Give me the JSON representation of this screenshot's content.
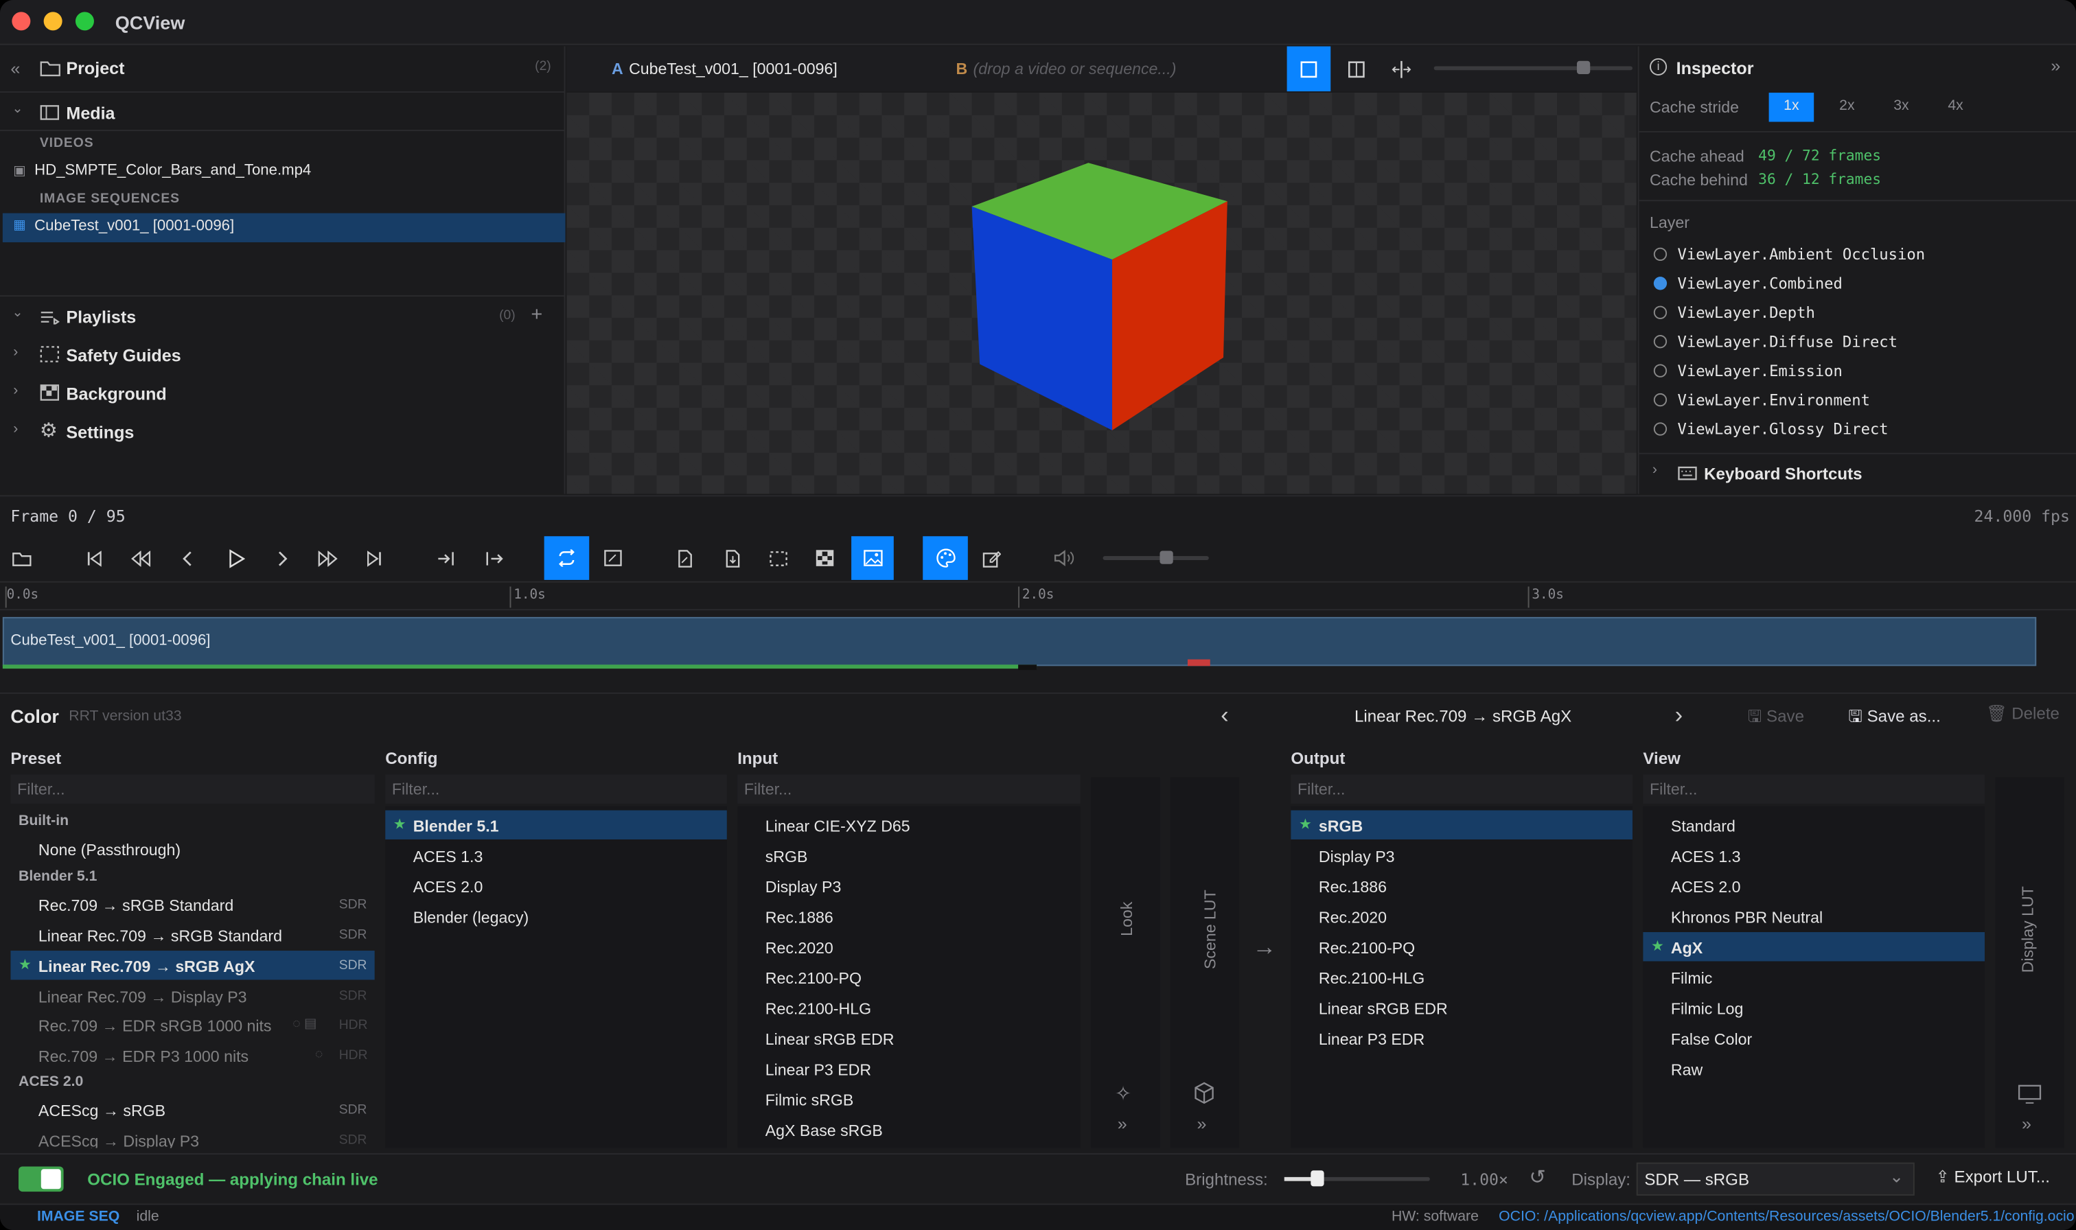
{
  "app": {
    "title": "QCView"
  },
  "project": {
    "title": "Project",
    "count": "(2)",
    "media_label": "Media",
    "videos_header": "VIDEOS",
    "videos": [
      "HD_SMPTE_Color_Bars_and_Tone.mp4"
    ],
    "seq_header": "IMAGE SEQUENCES",
    "sequences": [
      "CubeTest_v001_ [0001-0096]"
    ],
    "playlists_label": "Playlists",
    "playlists_count": "(0)",
    "safety_label": "Safety Guides",
    "background_label": "Background",
    "settings_label": "Settings"
  },
  "viewer": {
    "slot_a_letter": "A",
    "slot_a": "CubeTest_v001_ [0001-0096]",
    "slot_b_letter": "B",
    "slot_b": "(drop a video or sequence...)",
    "zoom_level": 0.75
  },
  "inspector": {
    "title": "Inspector",
    "cache_stride_label": "Cache stride",
    "strides": [
      "1x",
      "2x",
      "3x",
      "4x"
    ],
    "cache_ahead_label": "Cache ahead",
    "cache_ahead_value": "49 / 72 frames",
    "cache_behind_label": "Cache behind",
    "cache_behind_value": "36 / 12 frames",
    "layer_label": "Layer",
    "layers": [
      "ViewLayer.Ambient Occlusion",
      "ViewLayer.Combined",
      "ViewLayer.Depth",
      "ViewLayer.Diffuse Direct",
      "ViewLayer.Emission",
      "ViewLayer.Environment",
      "ViewLayer.Glossy Direct"
    ],
    "keyboard_label": "Keyboard Shortcuts"
  },
  "transport": {
    "frame": "Frame 0 / 95",
    "fps": "24.000 fps",
    "volume_level": 0.6
  },
  "timeline": {
    "ticks": [
      "0.0s",
      "1.0s",
      "2.0s",
      "3.0s"
    ],
    "clip": "CubeTest_v001_ [0001-0096]"
  },
  "color": {
    "title": "Color",
    "rrt": "RRT version ut33",
    "preset_name": "Linear Rec.709 → sRGB AgX",
    "save": "Save",
    "save_as": "Save as...",
    "delete": "Delete",
    "preset_header": "Preset",
    "config_header": "Config",
    "input_header": "Input",
    "output_header": "Output",
    "view_header": "View",
    "filter_placeholder": "Filter...",
    "builtin_label": "Built-in",
    "passthrough": "None (Passthrough)",
    "blender_label": "Blender 5.1",
    "aces_label": "ACES 2.0",
    "presets": [
      {
        "name": "Rec.709 → sRGB Standard",
        "tag": "SDR"
      },
      {
        "name": "Linear Rec.709 → sRGB Standard",
        "tag": "SDR"
      },
      {
        "name": "Linear Rec.709 → sRGB AgX",
        "tag": "SDR"
      },
      {
        "name": "Linear Rec.709 → Display P3",
        "tag": "SDR"
      },
      {
        "name": "Rec.709 → EDR sRGB 1000 nits",
        "tag": "HDR"
      },
      {
        "name": "Rec.709 → EDR P3 1000 nits",
        "tag": "HDR"
      }
    ],
    "aces_presets": [
      {
        "name": "ACEScg → sRGB",
        "tag": "SDR"
      },
      {
        "name": "ACEScg → Display P3",
        "tag": "SDR"
      }
    ],
    "configs": [
      "Blender 5.1",
      "ACES 1.3",
      "ACES 2.0",
      "Blender (legacy)"
    ],
    "inputs": [
      "Linear CIE-XYZ D65",
      "sRGB",
      "Display P3",
      "Rec.1886",
      "Rec.2020",
      "Rec.2100-PQ",
      "Rec.2100-HLG",
      "Linear sRGB EDR",
      "Linear P3 EDR",
      "Filmic sRGB",
      "AgX Base sRGB"
    ],
    "look_label": "Look",
    "scene_lut_label": "Scene LUT",
    "display_lut_label": "Display LUT",
    "outputs": [
      "sRGB",
      "Display P3",
      "Rec.1886",
      "Rec.2020",
      "Rec.2100-PQ",
      "Rec.2100-HLG",
      "Linear sRGB EDR",
      "Linear P3 EDR"
    ],
    "views": [
      "Standard",
      "ACES 1.3",
      "ACES 2.0",
      "Khronos PBR Neutral",
      "AgX",
      "Filmic",
      "Filmic Log",
      "False Color",
      "Raw"
    ],
    "ocio_status": "OCIO Engaged — applying chain live",
    "brightness_label": "Brightness:",
    "brightness_value": "1.00×",
    "brightness_level": 0.23,
    "display_label": "Display:",
    "display_value": "SDR — sRGB",
    "export": "Export LUT..."
  },
  "status": {
    "mode": "IMAGE SEQ",
    "state": "idle",
    "hw": "HW: software",
    "ocio_path": "OCIO: /Applications/qcview.app/Contents/Resources/assets/OCIO/Blender5.1/config.ocio"
  },
  "colors": {
    "accent": "#0a84ff",
    "selected": "#173d66",
    "green": "#4fc26a",
    "background": "#1b1b1d"
  }
}
